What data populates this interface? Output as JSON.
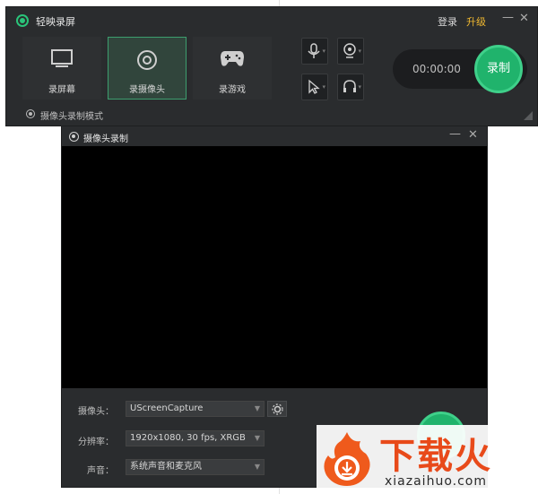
{
  "main_window": {
    "title": "轻映录屏",
    "login": "登录",
    "upgrade": "升级",
    "modes": [
      {
        "label": "录屏幕",
        "icon": "monitor-icon"
      },
      {
        "label": "录摄像头",
        "icon": "webcam-icon",
        "active": true
      },
      {
        "label": "录游戏",
        "icon": "gamepad-icon"
      }
    ],
    "tools": [
      "microphone-icon",
      "webcam-small-icon",
      "cursor-icon",
      "headphone-icon"
    ],
    "timer": "00:00:00",
    "record_label": "录制",
    "mode_hint": "摄像头录制模式",
    "accent": "#20b36c",
    "upgrade_color": "#f0b830"
  },
  "camera_window": {
    "title": "摄像头录制",
    "fields": [
      {
        "label": "摄像头：",
        "value": "UScreenCapture"
      },
      {
        "label": "分辨率：",
        "value": "1920x1080, 30 fps, XRGB"
      },
      {
        "label": "声音：",
        "value": "系统声音和麦克风"
      }
    ]
  },
  "watermark": {
    "cn": "下载火",
    "en": "xiazaihuo.com"
  }
}
